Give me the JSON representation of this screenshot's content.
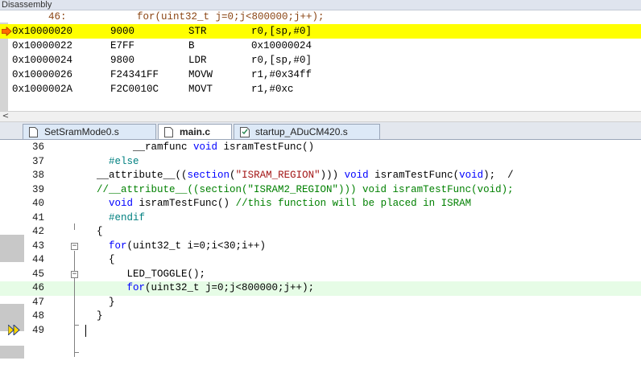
{
  "disassembly": {
    "title": "Disassembly",
    "source_line": {
      "number": "46:",
      "code": "for(uint32_t j=0;j<800000;j++);"
    },
    "rows": [
      {
        "addr": "0x10000020",
        "op": "9000",
        "mn": "STR",
        "args": "r0,[sp,#0]",
        "current": true
      },
      {
        "addr": "0x10000022",
        "op": "E7FF",
        "mn": "B",
        "args": "0x10000024"
      },
      {
        "addr": "0x10000024",
        "op": "9800",
        "mn": "LDR",
        "args": "r0,[sp,#0]"
      },
      {
        "addr": "0x10000026",
        "op": "F24341FF",
        "mn": "MOVW",
        "args": "r1,#0x34ff"
      },
      {
        "addr": "0x1000002A",
        "op": "F2C0010C",
        "mn": "MOVT",
        "args": "r1,#0xc"
      }
    ],
    "scroll_left": "<"
  },
  "tabs": [
    {
      "label": "SetSramMode0.s",
      "active": false,
      "icon": "file-icon"
    },
    {
      "label": "main.c",
      "active": true,
      "icon": "file-icon"
    },
    {
      "label": "startup_ADuCM420.s",
      "active": false,
      "icon": "settings-file-icon"
    }
  ],
  "editor": {
    "lines": [
      {
        "n": "36",
        "tokens": [
          [
            "",
            "      __ramfunc "
          ],
          [
            "kw",
            "void"
          ],
          [
            "",
            " isramTestFunc()"
          ]
        ]
      },
      {
        "n": "37",
        "tokens": [
          [
            "pp",
            "  #else"
          ]
        ]
      },
      {
        "n": "38",
        "tokens": [
          [
            "",
            "__attribute__(("
          ],
          [
            "kw",
            "section"
          ],
          [
            "",
            "("
          ],
          [
            "str",
            "\"ISRAM_REGION\""
          ],
          [
            "",
            "))) "
          ],
          [
            "kw",
            "void"
          ],
          [
            "",
            " isramTestFunc("
          ],
          [
            "kw",
            "void"
          ],
          [
            "",
            ");  /"
          ]
        ]
      },
      {
        "n": "39",
        "tokens": [
          [
            "cmt",
            "//__attribute__((section(\"ISRAM2_REGION\"))) void isramTestFunc(void);"
          ]
        ]
      },
      {
        "n": "40",
        "tokens": [
          [
            "",
            "  "
          ],
          [
            "kw",
            "void"
          ],
          [
            "",
            " isramTestFunc() "
          ],
          [
            "cmt",
            "//this function will be placed in ISRAM"
          ]
        ]
      },
      {
        "n": "41",
        "tokens": [
          [
            "pp",
            "  #endif"
          ]
        ]
      },
      {
        "n": "42",
        "tokens": [
          [
            "",
            "{"
          ]
        ]
      },
      {
        "n": "43",
        "tokens": [
          [
            "",
            "  "
          ],
          [
            "kw",
            "for"
          ],
          [
            "",
            "(uint32_t i=0;i<30;i++)"
          ]
        ]
      },
      {
        "n": "44",
        "tokens": [
          [
            "",
            "  {"
          ]
        ]
      },
      {
        "n": "45",
        "tokens": [
          [
            "",
            "     LED_TOGGLE();"
          ]
        ]
      },
      {
        "n": "46",
        "tokens": [
          [
            "",
            "     "
          ],
          [
            "kw",
            "for"
          ],
          [
            "",
            "(uint32_t j=0;j<800000;j++);"
          ]
        ],
        "current": true
      },
      {
        "n": "47",
        "tokens": [
          [
            "",
            "  }"
          ]
        ]
      },
      {
        "n": "48",
        "tokens": [
          [
            "",
            "}"
          ]
        ]
      },
      {
        "n": "49",
        "tokens": []
      }
    ]
  }
}
